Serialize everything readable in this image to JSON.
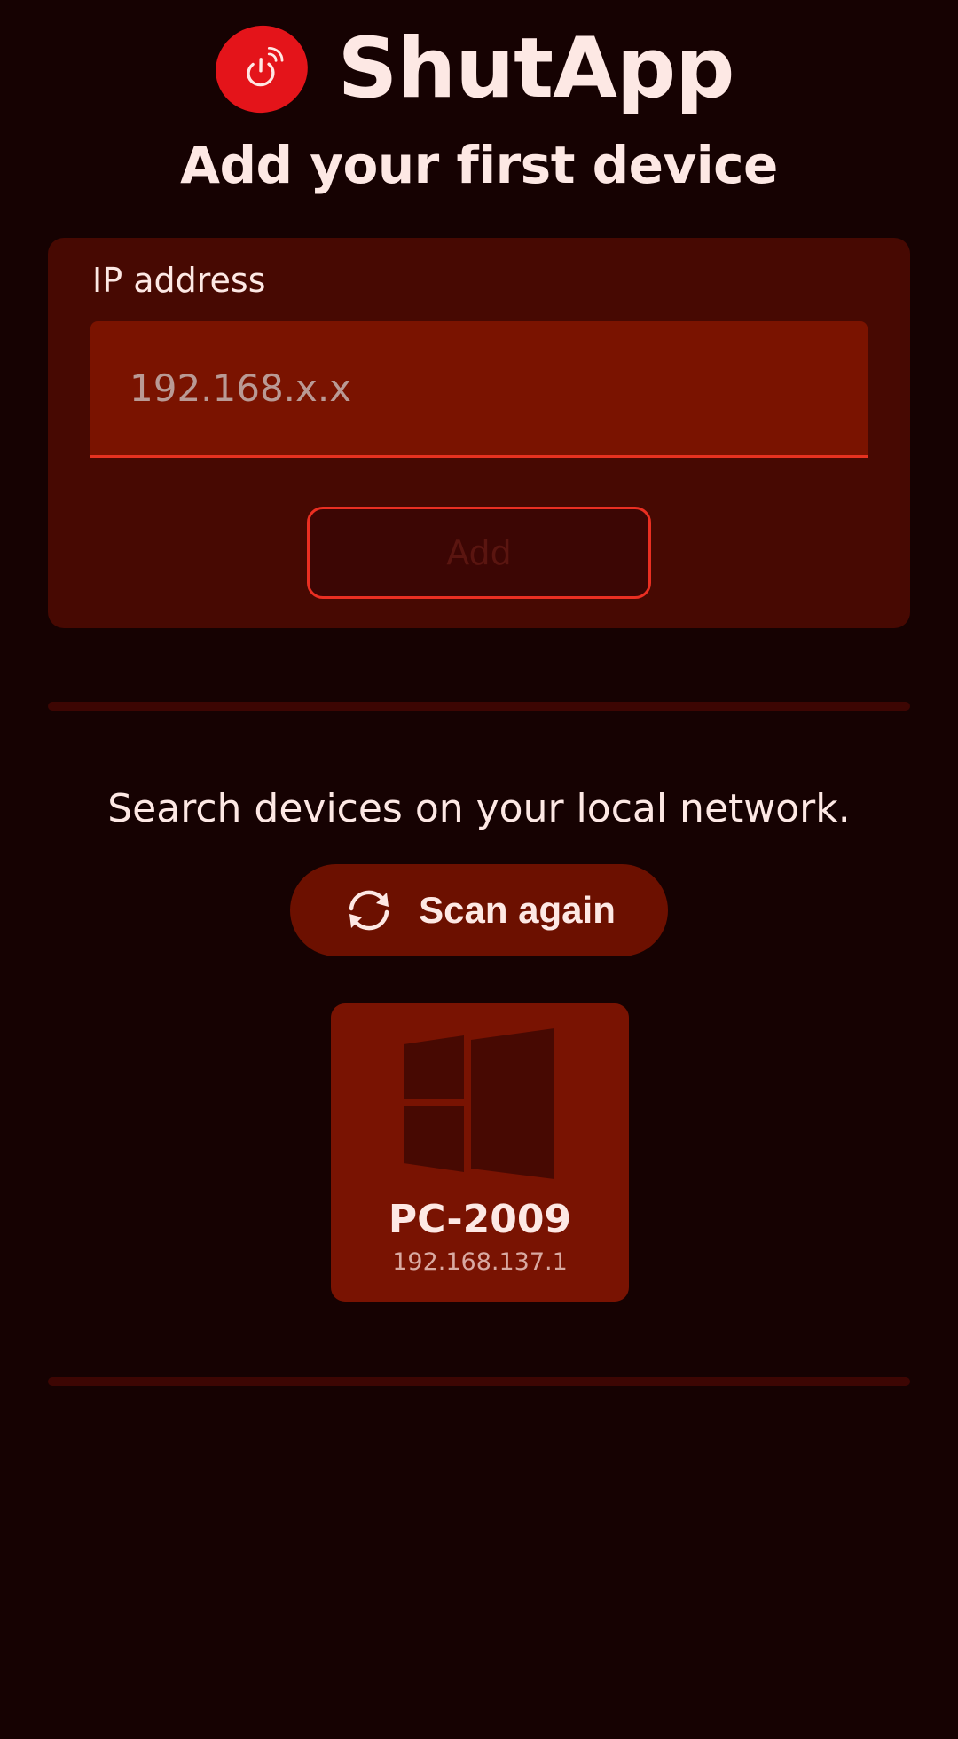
{
  "header": {
    "app_title": "ShutApp",
    "logo_icon": "power-wifi-icon",
    "page_title": "Add your first device"
  },
  "ip_card": {
    "label": "IP address",
    "input_value": "",
    "input_placeholder": "192.168.x.x",
    "add_label": "Add"
  },
  "scan": {
    "description": "Search devices on your local network.",
    "button_label": "Scan again",
    "button_icon": "refresh-icon"
  },
  "devices": [
    {
      "name": "PC-2009",
      "ip": "192.168.137.1",
      "icon": "windows-icon"
    }
  ],
  "colors": {
    "background": "#160202",
    "card": "#470902",
    "field": "#7a1300",
    "accent": "#e4141a",
    "tile": "#791302"
  }
}
